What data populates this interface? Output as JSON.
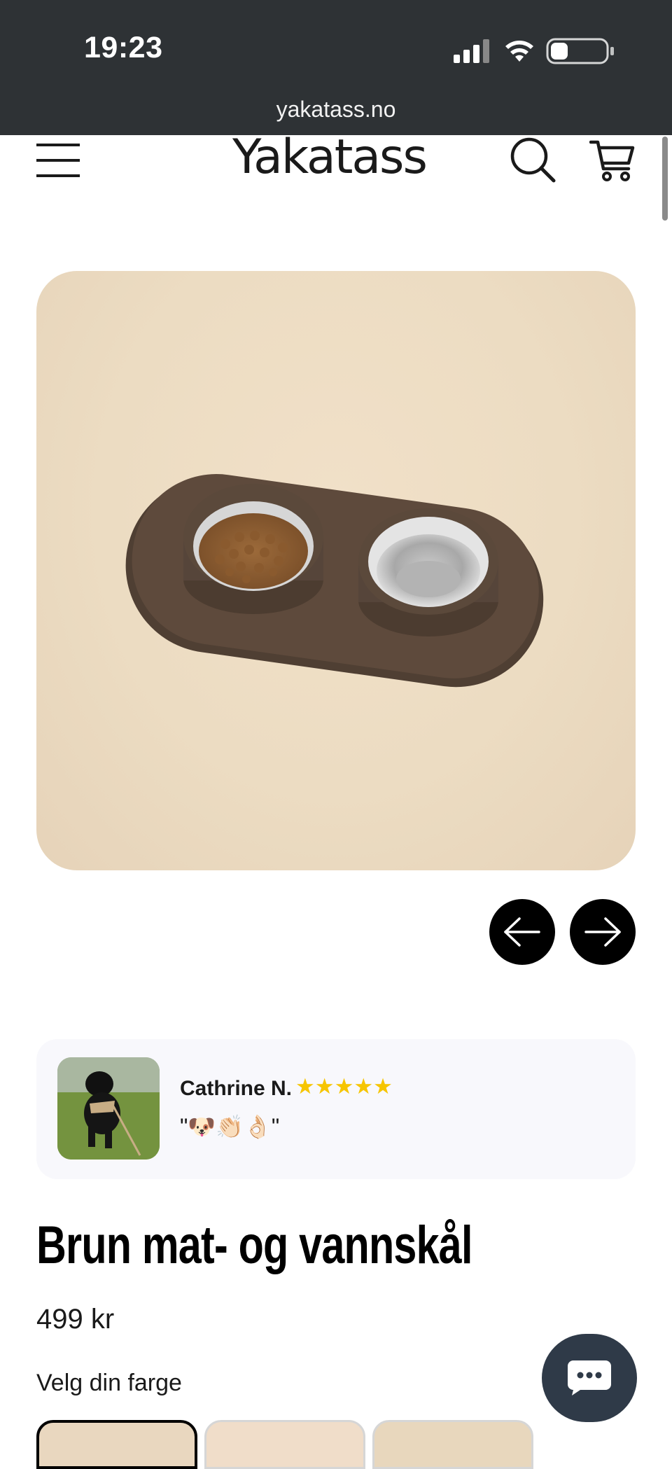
{
  "status_bar": {
    "time": "19:23",
    "icons": [
      "signal-icon",
      "wifi-icon",
      "battery-icon"
    ]
  },
  "browser": {
    "url": "yakatass.no"
  },
  "header": {
    "logo": "Yakatass",
    "icons": [
      "menu-icon",
      "search-icon",
      "cart-icon"
    ]
  },
  "product": {
    "image_alt": "Brun mat- og vannskål",
    "title": "Brun mat- og vannskål",
    "price": "499 kr",
    "color_label": "Velg din farge",
    "swatches": [
      {
        "name": "brown",
        "selected": true
      },
      {
        "name": "beige",
        "selected": false
      },
      {
        "name": "sand",
        "selected": false
      }
    ]
  },
  "carousel": {
    "prev_icon": "arrow-left-icon",
    "next_icon": "arrow-right-icon"
  },
  "review": {
    "name": "Cathrine N.",
    "stars": "★★★★★",
    "rating": 5,
    "text": "\"🐶👏🏻👌🏻\""
  },
  "chat": {
    "icon": "chat-bubble-icon"
  },
  "colors": {
    "status_bar_bg": "#2e3235",
    "chat_bg": "#2f3a48",
    "star_color": "#f6c500",
    "mat_brown": "#5e4a3c"
  }
}
